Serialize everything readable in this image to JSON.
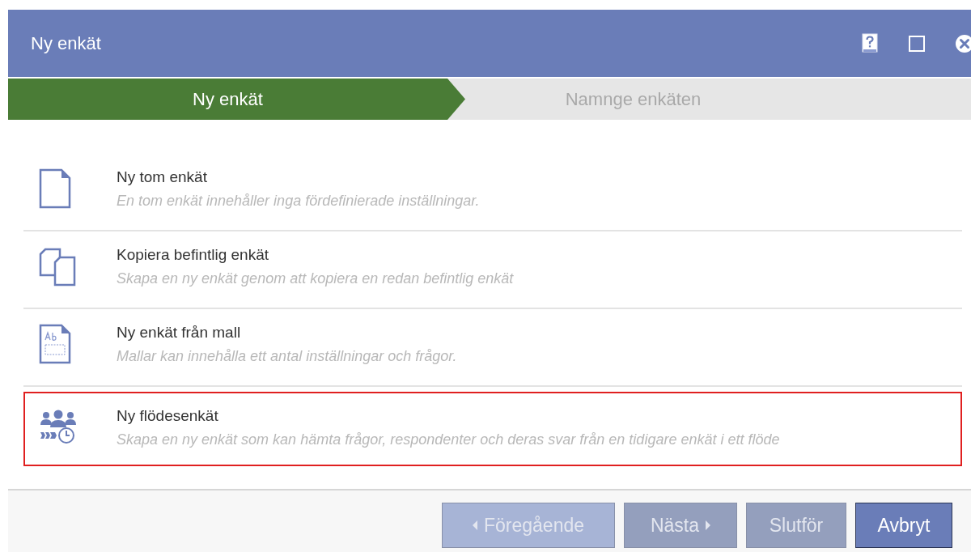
{
  "window": {
    "title": "Ny enkät"
  },
  "steps": [
    {
      "label": "Ny enkät",
      "selected": true
    },
    {
      "label": "Namnge enkäten",
      "selected": false
    }
  ],
  "options": [
    {
      "kind": "blank",
      "title": "Ny tom enkät",
      "description": "En tom enkät innehåller inga fördefinierade inställningar.",
      "selected": false
    },
    {
      "kind": "copy",
      "title": "Kopiera befintlig enkät",
      "description": "Skapa en ny enkät genom att kopiera en redan befintlig enkät",
      "selected": false
    },
    {
      "kind": "template",
      "title": "Ny enkät från mall",
      "description": "Mallar kan innehålla ett antal inställningar och frågor.",
      "selected": false
    },
    {
      "kind": "flow",
      "title": "Ny flödesenkät",
      "description": "Skapa en ny enkät som kan hämta frågor, respondenter och deras svar från en tidigare enkät i ett flöde",
      "selected": true
    }
  ],
  "buttons": [
    {
      "kind": "back",
      "label": "Föregående",
      "disabled": true
    },
    {
      "kind": "next",
      "label": "Nästa",
      "disabled": true
    },
    {
      "kind": "finish",
      "label": "Slutför",
      "disabled": true
    },
    {
      "kind": "cancel",
      "label": "Avbryt",
      "disabled": false
    }
  ]
}
